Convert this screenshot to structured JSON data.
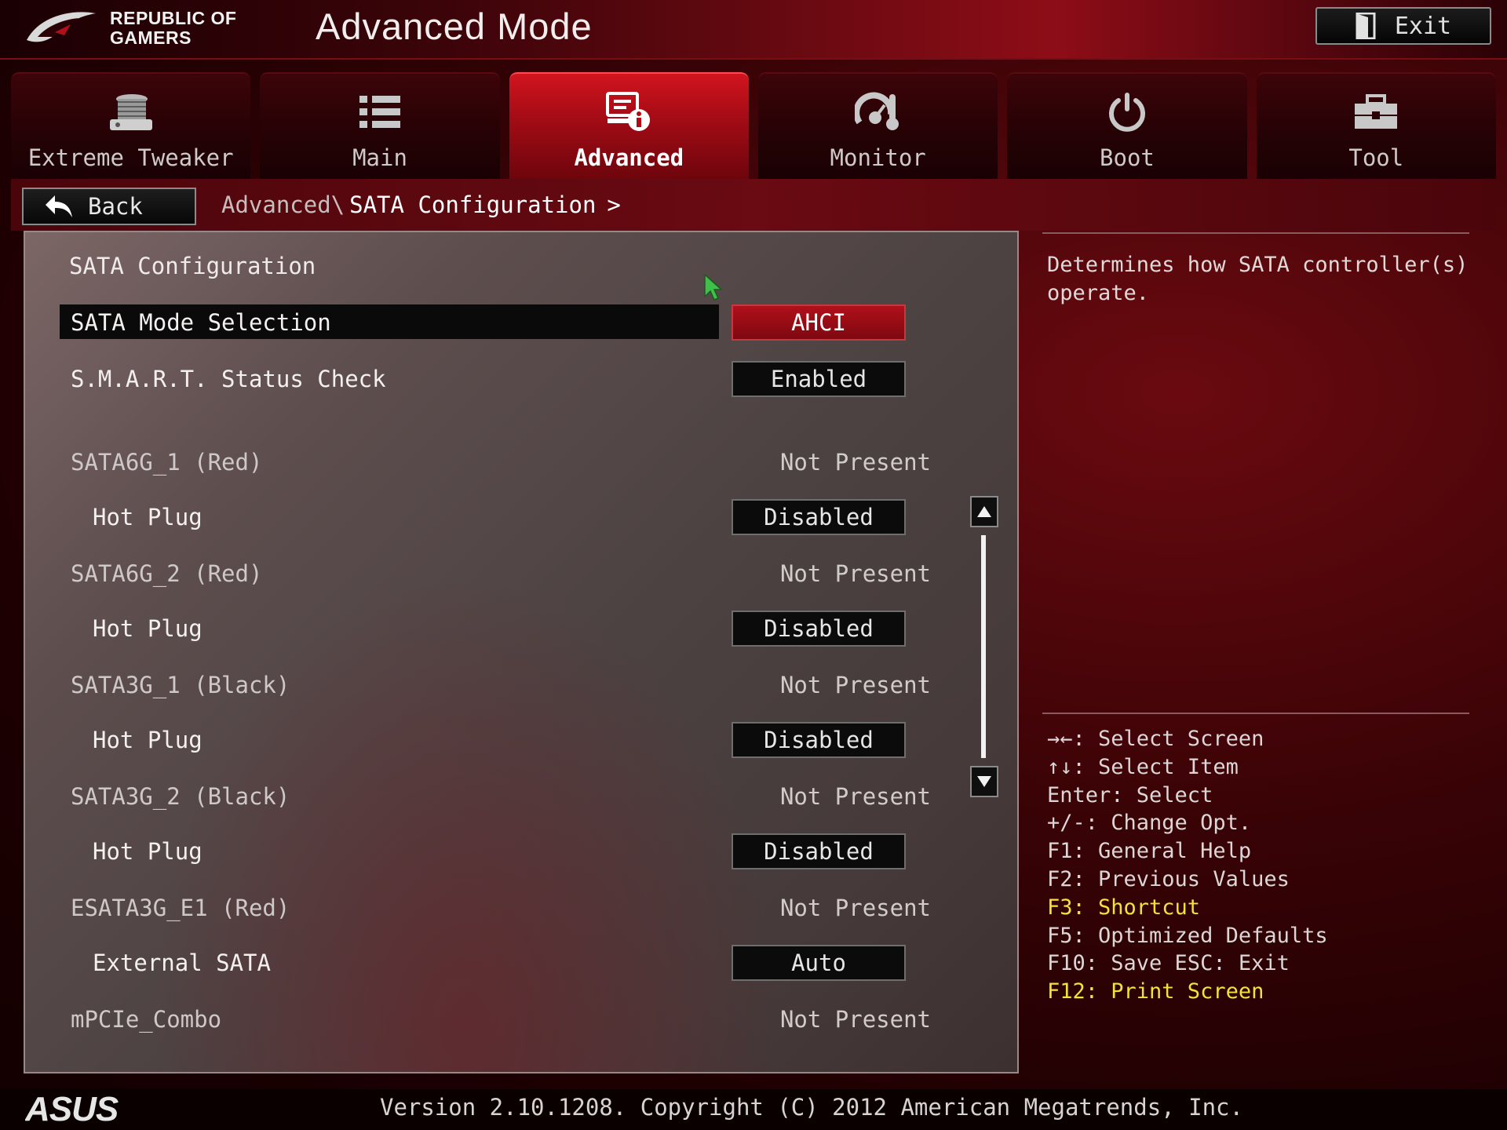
{
  "brand": {
    "line1": "REPUBLIC OF",
    "line2": "GAMERS"
  },
  "header": {
    "title": "Advanced Mode",
    "exit_label": "Exit"
  },
  "tabs": [
    {
      "label": "Extreme Tweaker",
      "icon": "extreme-tweaker-icon",
      "active": false
    },
    {
      "label": "Main",
      "icon": "list-icon",
      "active": false
    },
    {
      "label": "Advanced",
      "icon": "advanced-info-icon",
      "active": true
    },
    {
      "label": "Monitor",
      "icon": "thermometer-gauge-icon",
      "active": false
    },
    {
      "label": "Boot",
      "icon": "power-icon",
      "active": false
    },
    {
      "label": "Tool",
      "icon": "toolbox-icon",
      "active": false
    }
  ],
  "nav": {
    "back_label": "Back",
    "breadcrumb_parent": "Advanced\\",
    "breadcrumb_current": "SATA Configuration",
    "breadcrumb_arrow": ">"
  },
  "panel": {
    "title": "SATA Configuration",
    "rows": [
      {
        "label": "SATA Mode Selection",
        "value": "AHCI"
      },
      {
        "label": "S.M.A.R.T. Status Check",
        "value": "Enabled"
      },
      {
        "label": "SATA6G_1 (Red)",
        "status": "Not Present"
      },
      {
        "label": "Hot Plug",
        "value": "Disabled"
      },
      {
        "label": "SATA6G_2 (Red)",
        "status": "Not Present"
      },
      {
        "label": "Hot Plug",
        "value": "Disabled"
      },
      {
        "label": "SATA3G_1 (Black)",
        "status": "Not Present"
      },
      {
        "label": "Hot Plug",
        "value": "Disabled"
      },
      {
        "label": "SATA3G_2 (Black)",
        "status": "Not Present"
      },
      {
        "label": "Hot Plug",
        "value": "Disabled"
      },
      {
        "label": "ESATA3G_E1 (Red)",
        "status": "Not Present"
      },
      {
        "label": "External SATA",
        "value": "Auto"
      },
      {
        "label": "mPCIe_Combo",
        "status": "Not Present"
      }
    ]
  },
  "help": {
    "line1": "Determines how SATA controller(s)",
    "line2": "operate."
  },
  "keys": [
    "→←: Select Screen",
    "↑↓: Select Item",
    "Enter: Select",
    "+/-: Change Opt.",
    "F1: General Help",
    "F2: Previous Values",
    "F3: Shortcut",
    "F5: Optimized Defaults",
    "F10: Save  ESC: Exit",
    "F12: Print Screen"
  ],
  "footer": {
    "logo": "ASUS",
    "version": "Version 2.10.1208. Copyright (C) 2012 American Megatrends, Inc."
  },
  "colors": {
    "accent": "#c0101a",
    "highlight": "#f2e23a"
  }
}
